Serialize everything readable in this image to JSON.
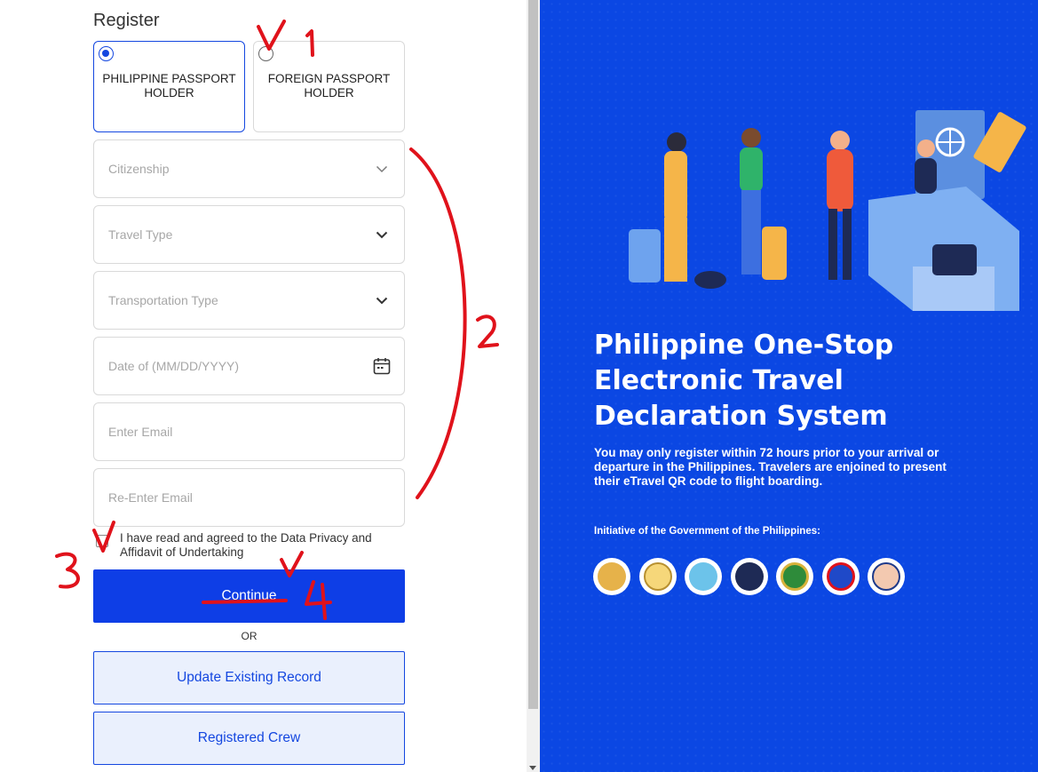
{
  "form": {
    "title": "Register",
    "passport_options": [
      {
        "label": "PHILIPPINE PASSPORT HOLDER",
        "selected": true
      },
      {
        "label": "FOREIGN PASSPORT HOLDER",
        "selected": false
      }
    ],
    "fields": {
      "citizenship": "Citizenship",
      "travel_type": "Travel Type",
      "transportation_type": "Transportation Type",
      "date": "Date of (MM/DD/YYYY)",
      "email": "Enter Email",
      "reenter_email": "Re-Enter Email"
    },
    "agreement": "I have read and agreed to the Data Privacy and Affidavit of Undertaking",
    "continue_label": "Continue",
    "or_label": "OR",
    "update_label": "Update Existing Record",
    "crew_label": "Registered Crew"
  },
  "hero": {
    "title": "Philippine One-Stop Electronic Travel Declaration System",
    "description": "You may only register within 72 hours prior to your arrival or departure in the Philippines. Travelers are enjoined to present their eTravel QR code to flight boarding.",
    "initiative": "Initiative of the Government of the Philippines:"
  },
  "annotations": {
    "mark_1": "1",
    "mark_2": "2",
    "mark_3": "3",
    "mark_4": "4"
  },
  "colors": {
    "primary": "#0e3ee6",
    "panel": "#0b47e3",
    "annotation": "#e0121b"
  }
}
